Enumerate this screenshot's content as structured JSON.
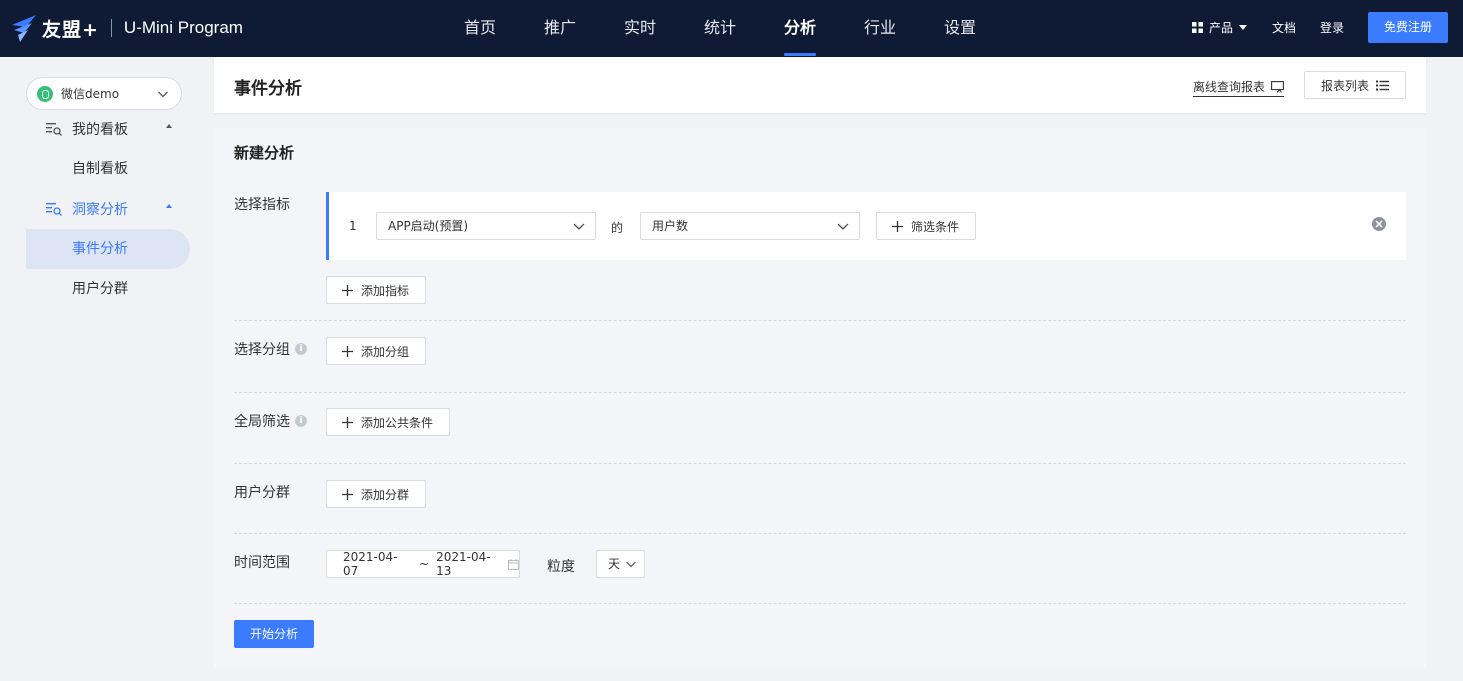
{
  "brand": {
    "name": "友盟+",
    "product": "U-Mini Program"
  },
  "nav": {
    "items": [
      {
        "label": "首页"
      },
      {
        "label": "推广"
      },
      {
        "label": "实时"
      },
      {
        "label": "统计"
      },
      {
        "label": "分析",
        "active": true
      },
      {
        "label": "行业"
      },
      {
        "label": "设置"
      }
    ]
  },
  "top_right": {
    "product": "产品",
    "docs": "文档",
    "login": "登录",
    "signup": "免费注册"
  },
  "sidebar": {
    "app_selector": "微信demo",
    "groups": [
      {
        "label": "我的看板",
        "items": [
          "自制看板"
        ]
      },
      {
        "label": "洞察分析",
        "items": [
          "事件分析",
          "用户分群"
        ],
        "active_item": "事件分析"
      }
    ]
  },
  "header": {
    "title": "事件分析",
    "offline_report": "离线查询报表",
    "report_list": "报表列表"
  },
  "form": {
    "section_title": "新建分析",
    "metric": {
      "label": "选择指标",
      "index": "1",
      "event": "APP启动(预置)",
      "of": "的",
      "measure": "用户数",
      "filter_button": "筛选条件",
      "add_button": "添加指标"
    },
    "group": {
      "label": "选择分组",
      "add_button": "添加分组"
    },
    "global_filter": {
      "label": "全局筛选",
      "add_button": "添加公共条件"
    },
    "segment": {
      "label": "用户分群",
      "add_button": "添加分群"
    },
    "time_range": {
      "label": "时间范围",
      "start": "2021-04-07",
      "separator": "~",
      "end": "2021-04-13",
      "granularity_label": "粒度",
      "granularity": "天"
    },
    "submit": "开始分析"
  },
  "colors": {
    "nav_bg": "#0f1b35",
    "accent": "#3a7bff",
    "sidebar_active_bg": "#dde5f4"
  }
}
